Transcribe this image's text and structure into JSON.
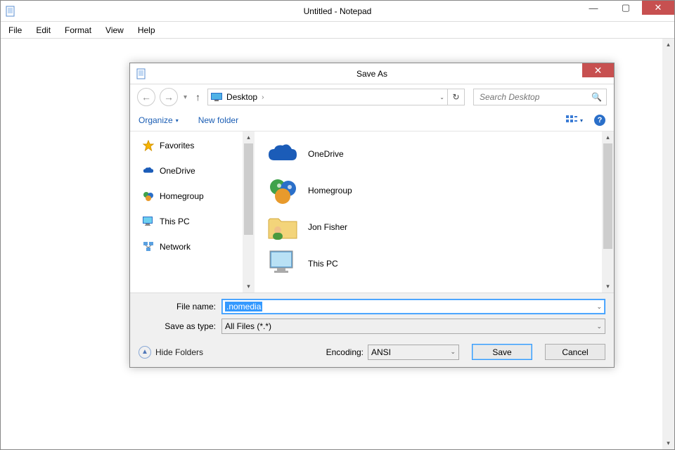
{
  "window": {
    "title": "Untitled - Notepad",
    "controls": {
      "min": "—",
      "max": "▢",
      "close": "✕"
    }
  },
  "menu": {
    "items": [
      "File",
      "Edit",
      "Format",
      "View",
      "Help"
    ]
  },
  "dialog": {
    "title": "Save As",
    "close": "✕",
    "nav": {
      "back": "←",
      "fwd": "→",
      "recent_drop": "▾",
      "up": "↑",
      "breadcrumb_loc": "Desktop",
      "breadcrumb_sep": "›",
      "breadcrumb_drop": "⌄",
      "refresh": "↻",
      "search_placeholder": "Search Desktop",
      "search_icon": "🔍"
    },
    "toolbar": {
      "organize": "Organize",
      "organize_drop": "▾",
      "new_folder": "New folder",
      "view_drop": "▾",
      "help": "?"
    },
    "sidebar": {
      "items": [
        {
          "label": "Favorites"
        },
        {
          "label": "OneDrive"
        },
        {
          "label": "Homegroup"
        },
        {
          "label": "This PC"
        },
        {
          "label": "Network"
        }
      ]
    },
    "files": {
      "items": [
        {
          "label": "OneDrive"
        },
        {
          "label": "Homegroup"
        },
        {
          "label": "Jon Fisher"
        },
        {
          "label": "This PC"
        }
      ]
    },
    "filename_label": "File name:",
    "filename_value": ".nomedia",
    "saveastype_label": "Save as type:",
    "saveastype_value": "All Files  (*.*)",
    "hide_folders": "Hide Folders",
    "encoding_label": "Encoding:",
    "encoding_value": "ANSI",
    "save_btn": "Save",
    "cancel_btn": "Cancel"
  }
}
